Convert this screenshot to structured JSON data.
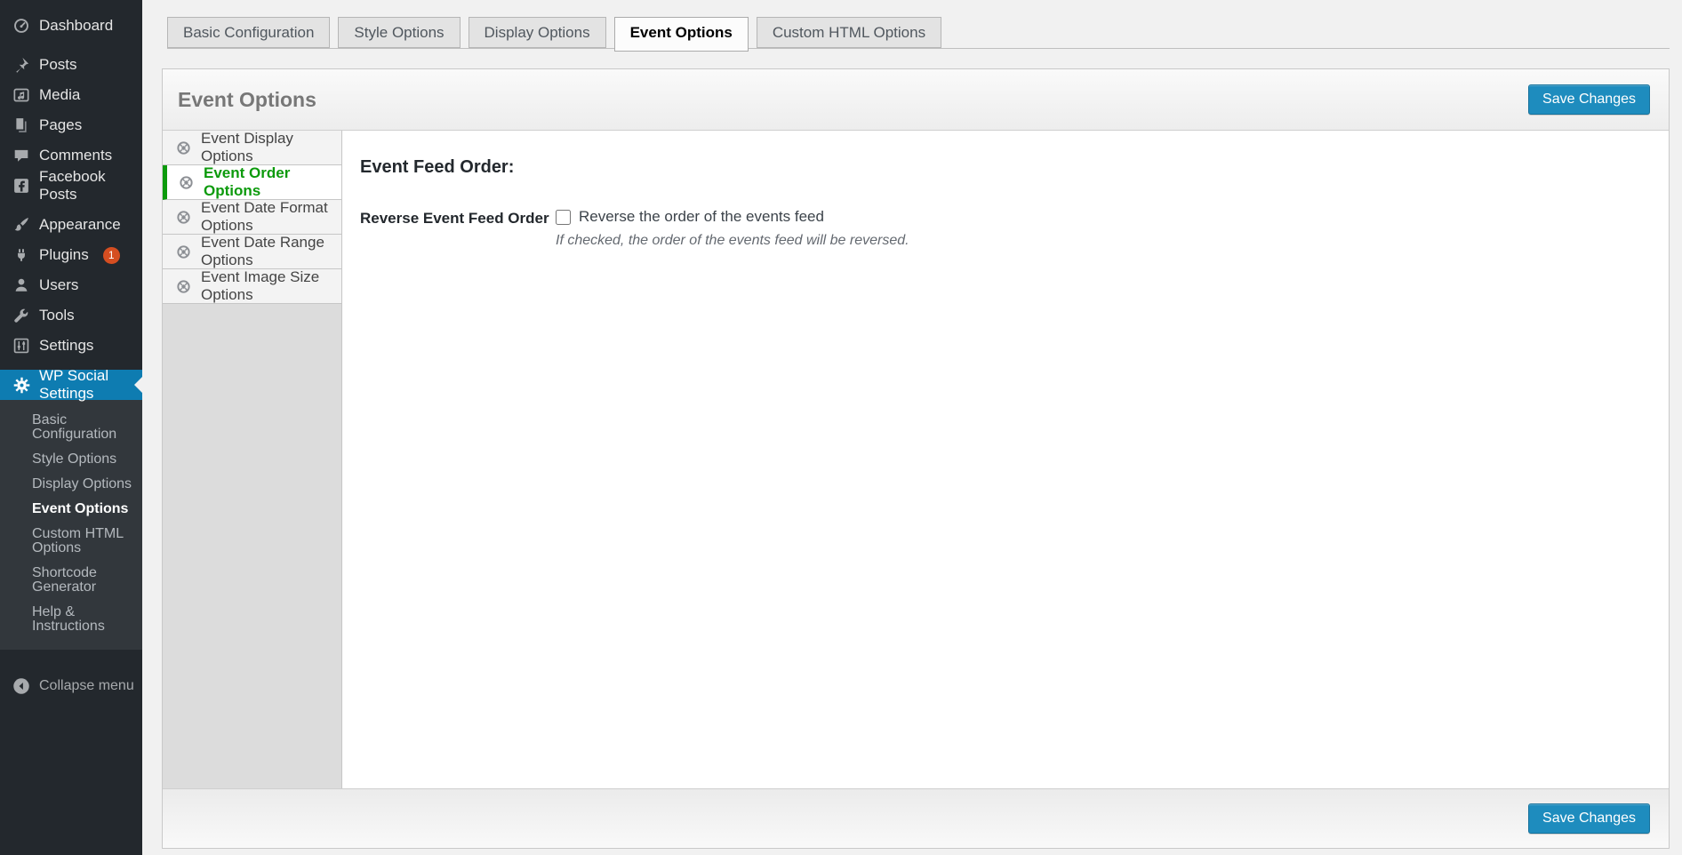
{
  "sidebar": {
    "items": [
      {
        "label": "Dashboard",
        "icon": "dashboard-icon"
      },
      {
        "label": "Posts",
        "icon": "pushpin-icon"
      },
      {
        "label": "Media",
        "icon": "media-icon"
      },
      {
        "label": "Pages",
        "icon": "pages-icon"
      },
      {
        "label": "Comments",
        "icon": "comment-icon"
      },
      {
        "label": "Facebook Posts",
        "icon": "facebook-icon"
      },
      {
        "label": "Appearance",
        "icon": "brush-icon"
      },
      {
        "label": "Plugins",
        "icon": "plug-icon",
        "badge": "1"
      },
      {
        "label": "Users",
        "icon": "user-icon"
      },
      {
        "label": "Tools",
        "icon": "wrench-icon"
      },
      {
        "label": "Settings",
        "icon": "sliders-icon"
      },
      {
        "label": "WP Social Settings",
        "icon": "gear-icon",
        "active": true
      }
    ],
    "submenu": [
      {
        "label": "Basic Configuration"
      },
      {
        "label": "Style Options"
      },
      {
        "label": "Display Options"
      },
      {
        "label": "Event Options",
        "active": true
      },
      {
        "label": "Custom HTML Options"
      },
      {
        "label": "Shortcode Generator"
      },
      {
        "label": "Help & Instructions"
      }
    ],
    "collapse_label": "Collapse menu",
    "collapse_icon": "collapse-arrow-icon"
  },
  "tabs": [
    {
      "label": "Basic Configuration"
    },
    {
      "label": "Style Options"
    },
    {
      "label": "Display Options"
    },
    {
      "label": "Event Options",
      "active": true
    },
    {
      "label": "Custom HTML Options"
    }
  ],
  "panel": {
    "title": "Event Options",
    "save_button": "Save Changes",
    "subnav": [
      {
        "label": "Event Display Options",
        "icon": "globe-icon"
      },
      {
        "label": "Event Order Options",
        "icon": "globe-icon",
        "active": true
      },
      {
        "label": "Event Date Format Options",
        "icon": "globe-icon"
      },
      {
        "label": "Event Date Range Options",
        "icon": "globe-icon"
      },
      {
        "label": "Event Image Size Options",
        "icon": "globe-icon"
      }
    ],
    "content": {
      "section_heading": "Event Feed Order:",
      "field_label": "Reverse Event Feed Order",
      "checkbox_label": "Reverse the order of the events feed",
      "checkbox_checked": false,
      "description": "If checked, the order of the events feed will be reversed."
    }
  },
  "colors": {
    "sidebar_bg": "#23282d",
    "submenu_bg": "#32373c",
    "active_blue": "#0e7cb1",
    "active_green": "#0c9a0c",
    "badge_red": "#d54e21",
    "button_blue": "#1e8cbe",
    "page_bg": "#f1f1f1"
  }
}
